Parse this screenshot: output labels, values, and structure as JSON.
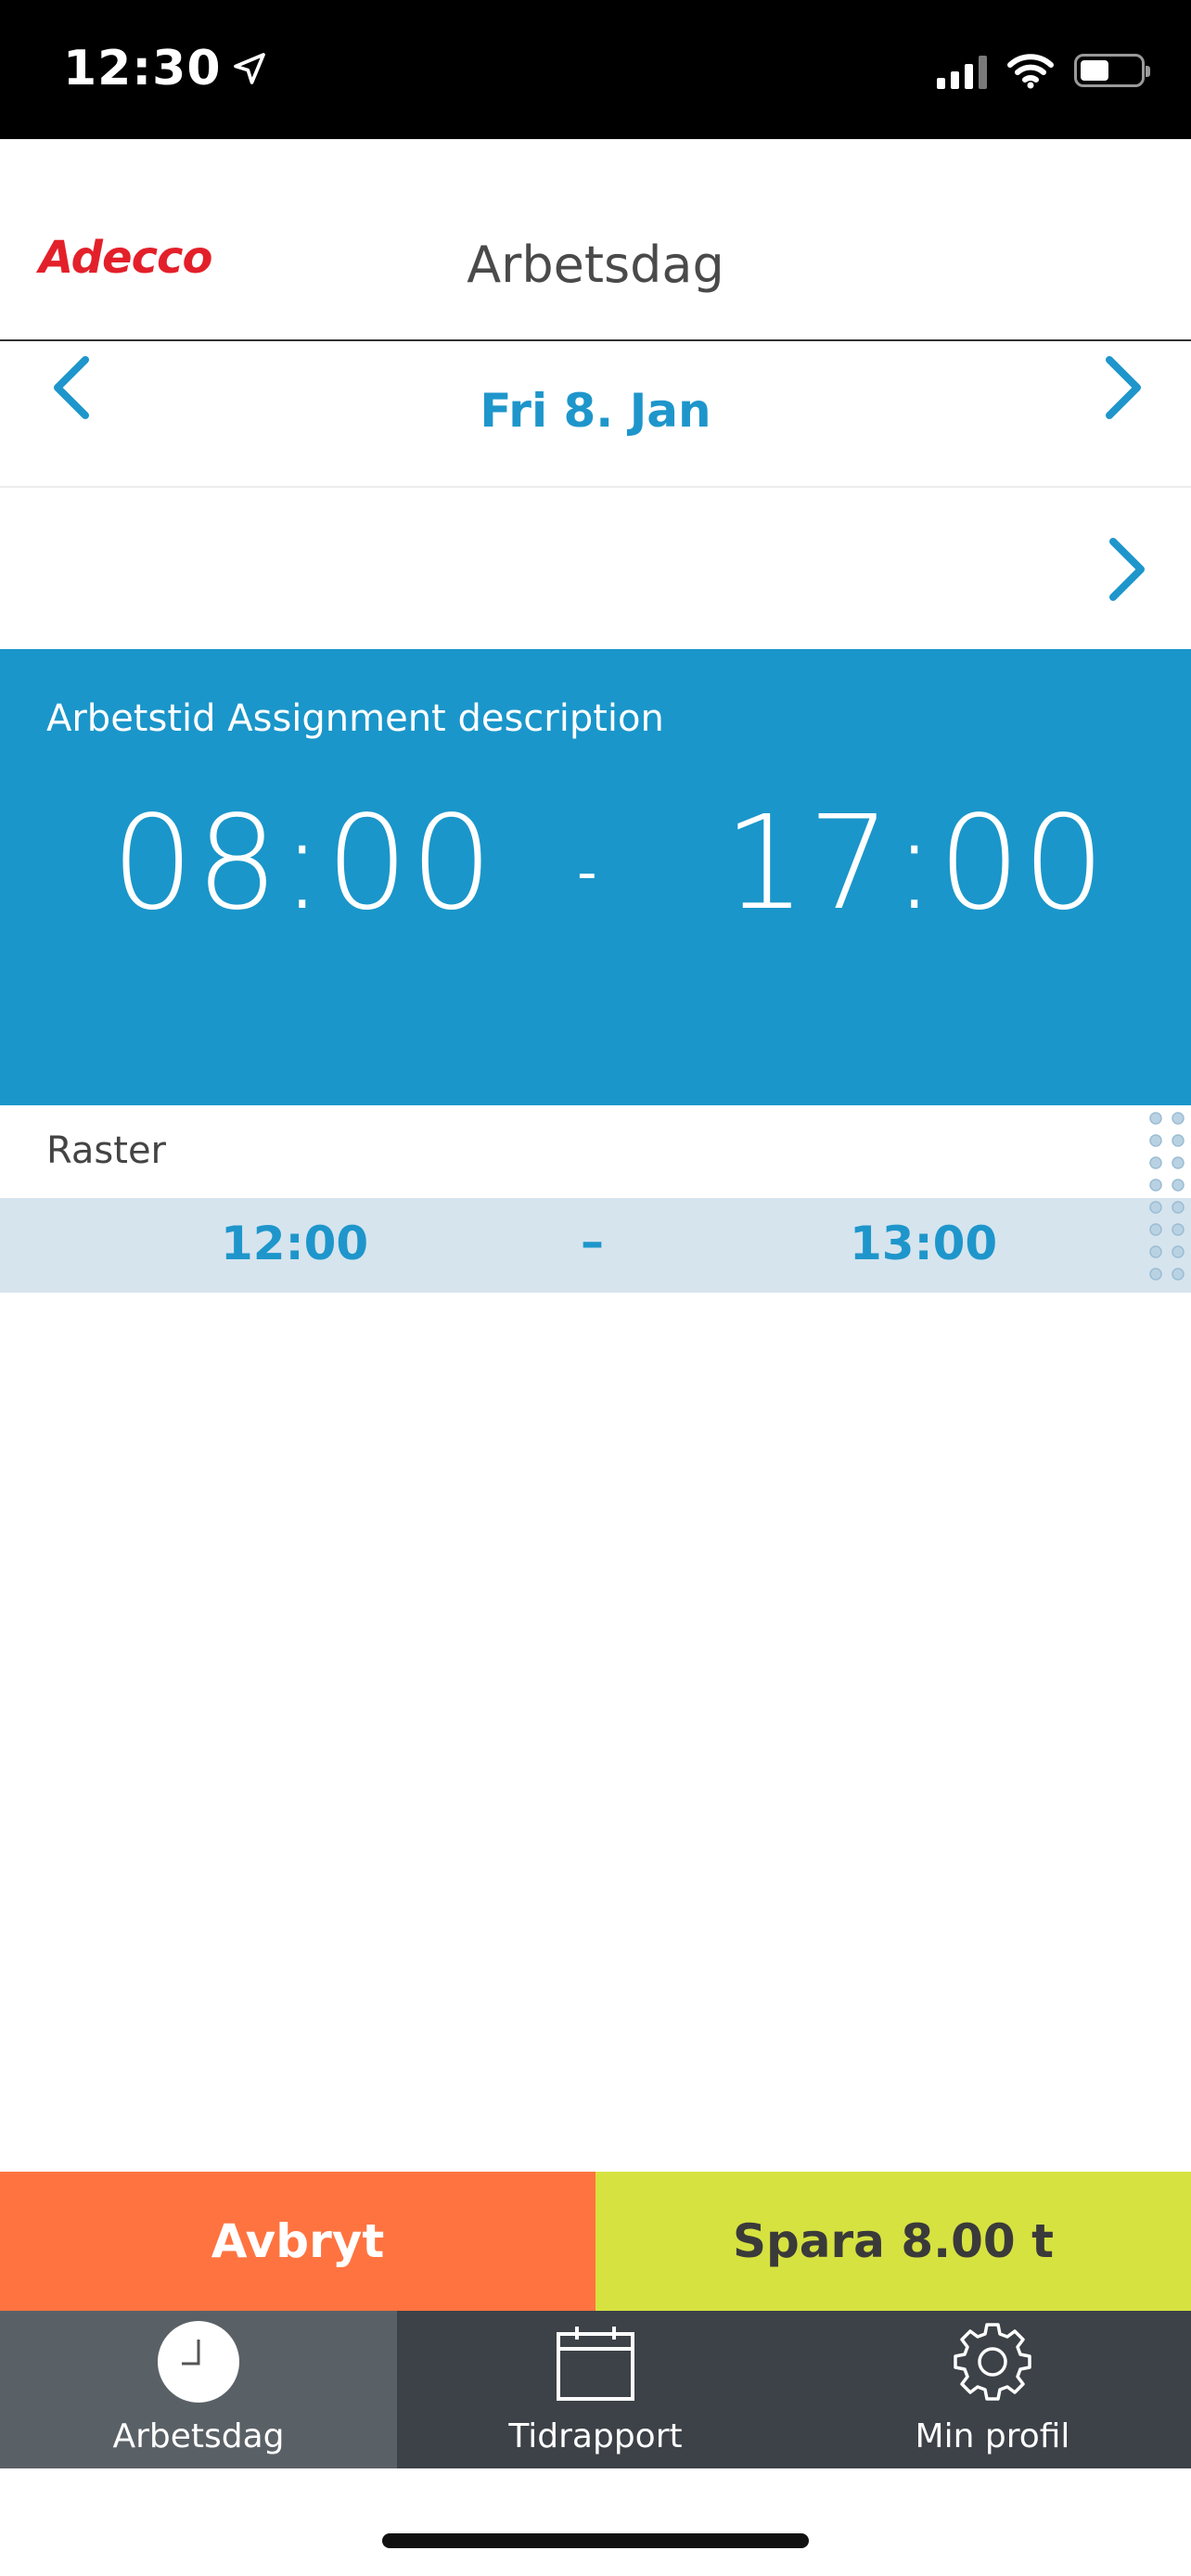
{
  "status_bar": {
    "time": "12:30"
  },
  "header": {
    "logo": "Adecco",
    "title": "Arbetsdag"
  },
  "date_nav": {
    "date": "Fri 8. Jan"
  },
  "work_time": {
    "label": "Arbetstid Assignment description",
    "start": "08:00",
    "separator": "-",
    "end": "17:00"
  },
  "break": {
    "label": "Raster",
    "start": "12:00",
    "separator": "–",
    "end": "13:00"
  },
  "actions": {
    "cancel_label": "Avbryt",
    "save_label": "Spara 8.00 t"
  },
  "tabs": [
    {
      "label": "Arbetsdag",
      "icon": "clock-icon",
      "active": true
    },
    {
      "label": "Tidrapport",
      "icon": "calendar-icon",
      "active": false
    },
    {
      "label": "Min profil",
      "icon": "gear-icon",
      "active": false
    }
  ],
  "colors": {
    "brand_red": "#e3202a",
    "accent_blue": "#1a96ca",
    "break_bg": "#d6e4ee",
    "cancel_orange": "#ff7340",
    "save_green": "#d6e240",
    "tabbar_bg": "#3c4247"
  }
}
